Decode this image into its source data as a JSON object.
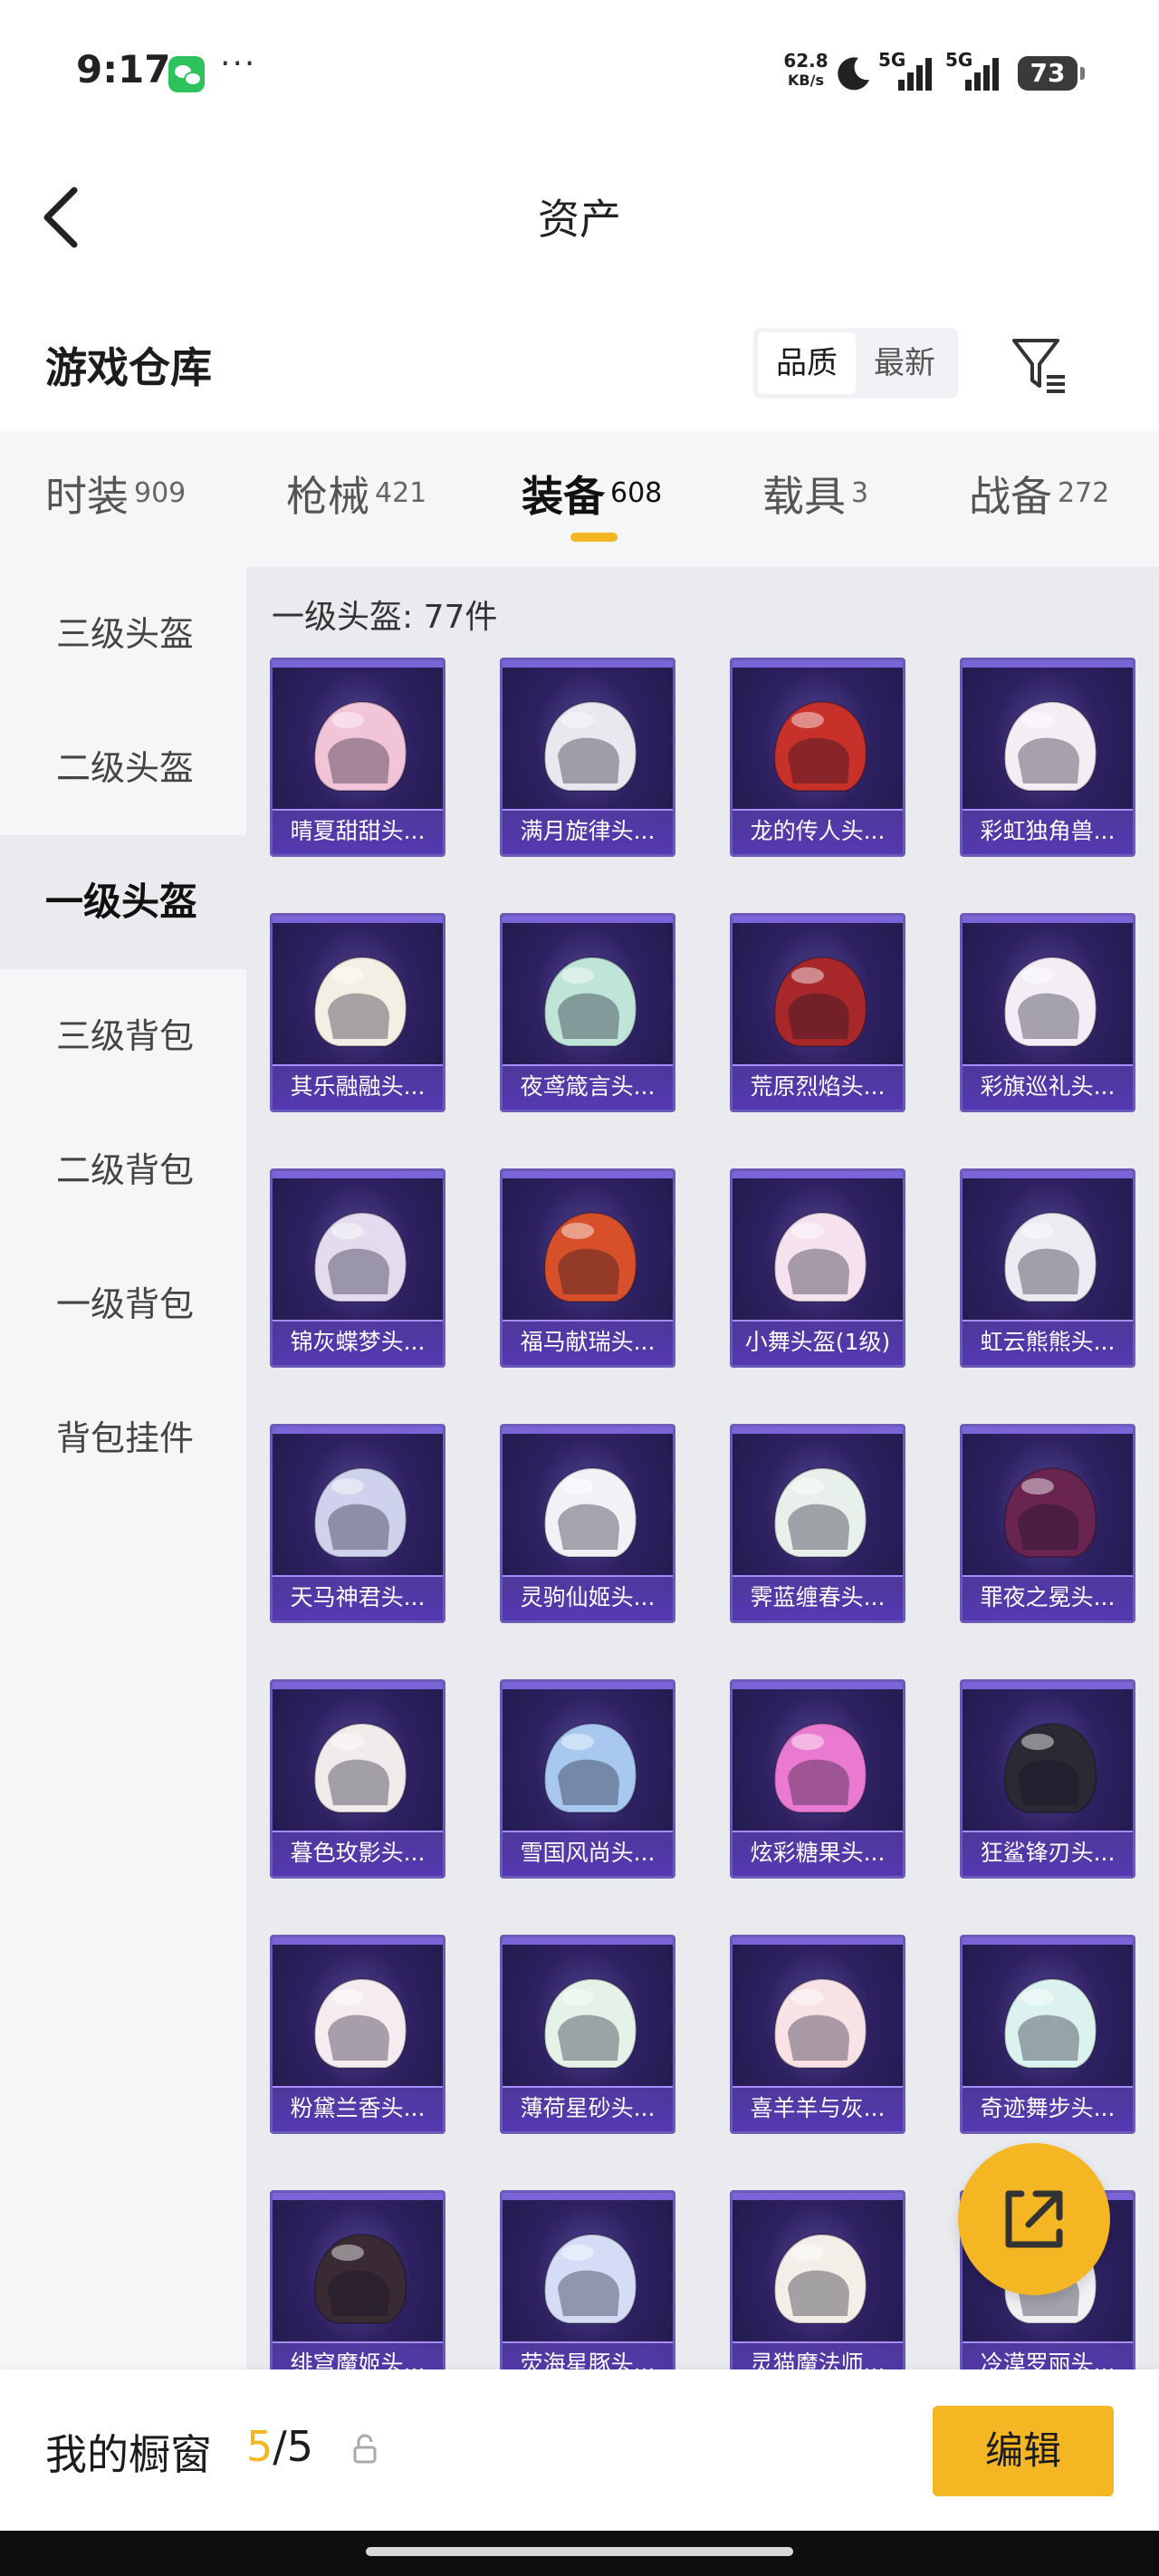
{
  "status_bar": {
    "time": "9:17",
    "net_speed_value": "62.8",
    "net_speed_unit": "KB/s",
    "signal1_label": "5G",
    "signal2_label": "5G",
    "battery": "73"
  },
  "header": {
    "title": "资产"
  },
  "warehouse": {
    "title": "游戏仓库",
    "sort_options": [
      "品质",
      "最新"
    ],
    "active_sort": "品质"
  },
  "tabs": [
    {
      "name": "时装",
      "count": "909"
    },
    {
      "name": "枪械",
      "count": "421"
    },
    {
      "name": "装备",
      "count": "608"
    },
    {
      "name": "载具",
      "count": "3"
    },
    {
      "name": "战备",
      "count": "272"
    }
  ],
  "active_tab": "装备",
  "sidebar": {
    "items": [
      "三级头盔",
      "二级头盔",
      "一级头盔",
      "三级背包",
      "二级背包",
      "一级背包",
      "背包挂件"
    ],
    "active": "一级头盔"
  },
  "section_title": "一级头盔: 77件",
  "items": [
    {
      "name": "晴夏甜甜头...",
      "color": "#f2c4d8"
    },
    {
      "name": "满月旋律头...",
      "color": "#e8e8ee"
    },
    {
      "name": "龙的传人头...",
      "color": "#c8302a"
    },
    {
      "name": "彩虹独角兽...",
      "color": "#f4eef4"
    },
    {
      "name": "其乐融融头...",
      "color": "#f4efe4"
    },
    {
      "name": "夜鸢箴言头...",
      "color": "#bfe4d8"
    },
    {
      "name": "荒原烈焰头...",
      "color": "#a8282a"
    },
    {
      "name": "彩旗巡礼头...",
      "color": "#f3eef6"
    },
    {
      "name": "锦灰蝶梦头...",
      "color": "#e2dcee"
    },
    {
      "name": "福马献瑞头...",
      "color": "#d8502a"
    },
    {
      "name": "小舞头盔(1级)",
      "color": "#f5e2ee"
    },
    {
      "name": "虹云熊熊头...",
      "color": "#eeeaf2"
    },
    {
      "name": "天马神君头...",
      "color": "#cfd2ec"
    },
    {
      "name": "灵驹仙姬头...",
      "color": "#f3f1f6"
    },
    {
      "name": "霁蓝缠春头...",
      "color": "#e8f0ec"
    },
    {
      "name": "罪夜之冕头...",
      "color": "#6a2450"
    },
    {
      "name": "暮色玫影头...",
      "color": "#f0ecec"
    },
    {
      "name": "雪国风尚头...",
      "color": "#a8c8f0"
    },
    {
      "name": "炫彩糖果头...",
      "color": "#ea7ad0"
    },
    {
      "name": "狂鲨锋刃头...",
      "color": "#2a2a34"
    },
    {
      "name": "粉黛兰香头...",
      "color": "#f4ecee"
    },
    {
      "name": "薄荷星砂头...",
      "color": "#e4f2e8"
    },
    {
      "name": "喜羊羊与灰...",
      "color": "#f8e2e6"
    },
    {
      "name": "奇迹舞步头...",
      "color": "#dcf2ee"
    },
    {
      "name": "绯穹魔姬头...",
      "color": "#3a2a34"
    },
    {
      "name": "荧海星豚头...",
      "color": "#d4dcf6"
    },
    {
      "name": "灵猫魔法师...",
      "color": "#f2eee8"
    },
    {
      "name": "冷漠罗丽头...",
      "color": "#f2f0f4"
    }
  ],
  "bottom_bar": {
    "title": "我的橱窗",
    "current": "5",
    "slash_total": "/5",
    "edit_label": "编辑"
  },
  "accent_color": "#f5b623"
}
